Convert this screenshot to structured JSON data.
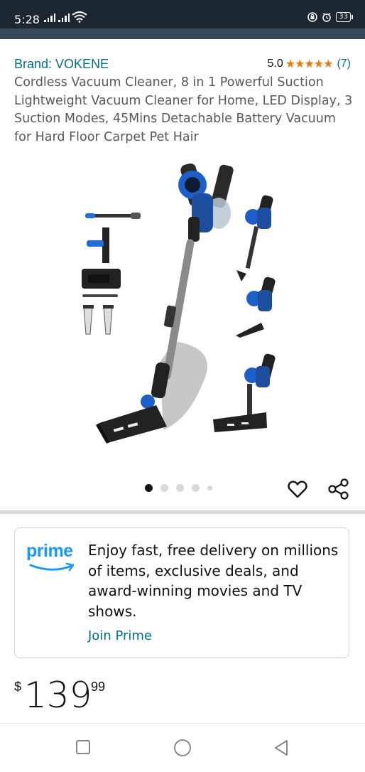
{
  "status_bar": {
    "time": "5:28",
    "battery": "33"
  },
  "product": {
    "brand_label": "Brand: VOKENE",
    "rating_score": "5.0",
    "stars": "★★★★★",
    "rating_value": 5,
    "review_count": "(7)",
    "title": "Cordless Vacuum Cleaner, 8 in 1 Powerful Suction Lightweight Vacuum Cleaner for Home, LED Display, 3 Suction Modes, 45Mins Detachable Battery Vacuum for Hard Floor Carpet Pet Hair",
    "image_count": 5,
    "active_image_index": 0
  },
  "prime": {
    "logo_text": "prime",
    "description": "Enjoy fast, free delivery on millions of items, exclusive deals, and award-winning movies and TV shows.",
    "join_label": "Join Prime"
  },
  "price": {
    "symbol": "$",
    "whole": "139",
    "fraction": "99"
  },
  "colors": {
    "link": "#007185",
    "star": "#e47911",
    "prime_blue": "#1a98ff",
    "status_bar": "#1c2631",
    "header_strip": "#37475a"
  },
  "icons": {
    "wishlist": "heart-icon",
    "share": "share-icon",
    "nav_recents": "square-icon",
    "nav_home": "circle-icon",
    "nav_back": "triangle-back-icon"
  }
}
